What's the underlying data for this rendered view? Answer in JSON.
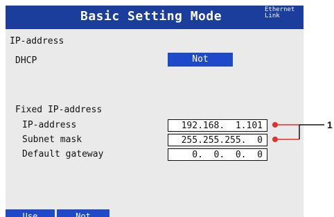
{
  "header": {
    "title": "Basic Setting Mode",
    "status_line1": "Ethernet",
    "status_line2": "Link"
  },
  "section": {
    "heading": "IP-address"
  },
  "dhcp": {
    "label": "DHCP",
    "value": "Not"
  },
  "fixed": {
    "heading": "Fixed IP-address",
    "rows": [
      {
        "label": "IP-address",
        "value": "192.168.  1.101"
      },
      {
        "label": "Subnet mask",
        "value": "255.255.255.  0"
      },
      {
        "label": "Default gateway",
        "value": "  0.  0.  0.  0"
      }
    ]
  },
  "softkeys": [
    "Use",
    "Not"
  ],
  "callout": {
    "number": "1",
    "color": "#e03030"
  },
  "colors": {
    "titlebar": "#1b3d9c",
    "selected": "#1e49c8",
    "screen_bg": "#eaeaea"
  }
}
